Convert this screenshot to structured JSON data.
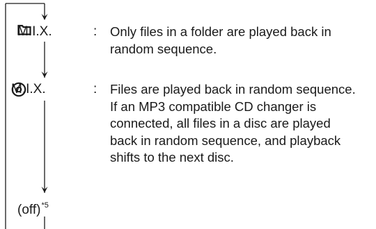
{
  "modes": [
    {
      "label": "M.I.X.",
      "icon": "folder-icon",
      "colon": ":",
      "description": [
        "Only files in a folder are played back in",
        "random sequence."
      ]
    },
    {
      "label": "M.I.X.",
      "icon": "disc-icon",
      "colon": ":",
      "description": [
        "Files are played back in random sequence.",
        "If an MP3 compatible CD changer is",
        "connected, all files in a disc are played",
        "back in random sequence, and playback",
        "shifts to the next disc."
      ]
    },
    {
      "label": "(off)",
      "footnote": "*5"
    }
  ]
}
